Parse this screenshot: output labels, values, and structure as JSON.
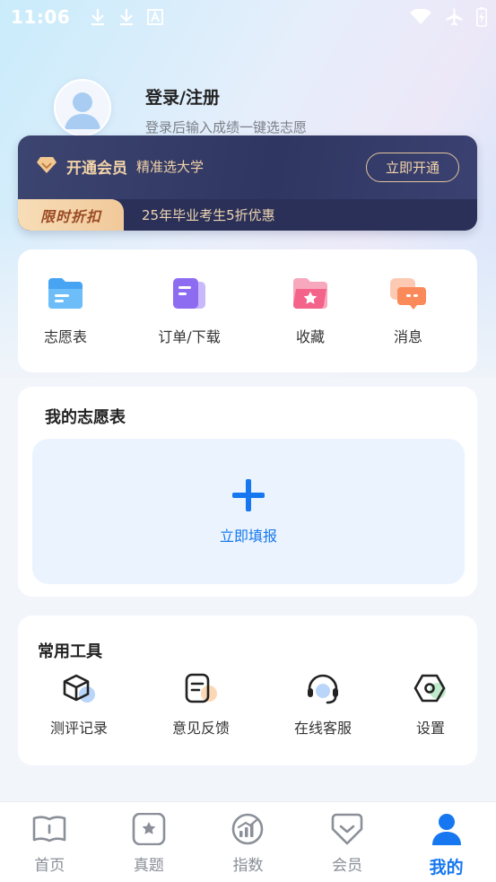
{
  "status_bar": {
    "time": "11:06"
  },
  "profile": {
    "title": "登录/注册",
    "subtitle": "登录后输入成绩一键选志愿"
  },
  "vip": {
    "title": "开通会员",
    "subtitle": "精准选大学",
    "button": "立即开通",
    "badge": "限时折扣",
    "promo": "25年毕业考生5折优惠",
    "accent_color": "#f3d3a8"
  },
  "quick_actions": [
    {
      "label": "志愿表",
      "icon": "folder-icon"
    },
    {
      "label": "订单/下载",
      "icon": "document-icon"
    },
    {
      "label": "收藏",
      "icon": "star-folder-icon"
    },
    {
      "label": "消息",
      "icon": "chat-icon"
    }
  ],
  "volunteer": {
    "title": "我的志愿表",
    "action": "立即填报"
  },
  "tools": {
    "title": "常用工具",
    "items": [
      {
        "label": "测评记录",
        "icon": "cube-icon"
      },
      {
        "label": "意见反馈",
        "icon": "feedback-icon"
      },
      {
        "label": "在线客服",
        "icon": "headset-icon"
      },
      {
        "label": "设置",
        "icon": "gear-icon"
      }
    ]
  },
  "tabbar": {
    "items": [
      {
        "label": "首页",
        "icon": "book-icon"
      },
      {
        "label": "真题",
        "icon": "star-square-icon"
      },
      {
        "label": "指数",
        "icon": "gauge-icon"
      },
      {
        "label": "会员",
        "icon": "vip-icon"
      },
      {
        "label": "我的",
        "icon": "user-icon"
      }
    ],
    "active_index": 4,
    "active_color": "#1677f0"
  }
}
